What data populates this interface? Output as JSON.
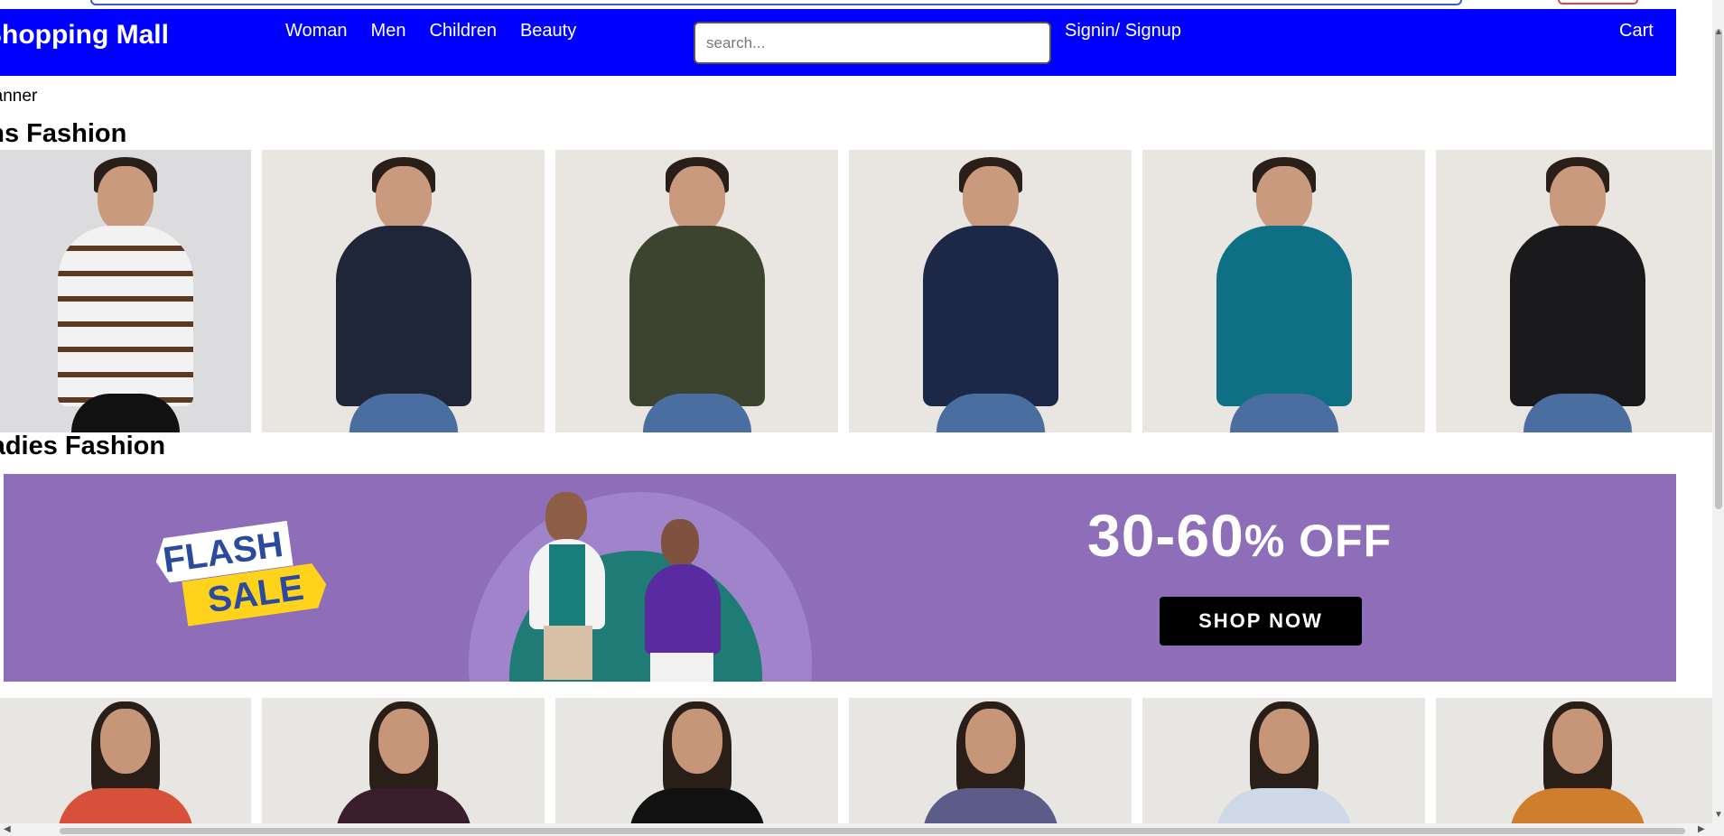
{
  "navbar": {
    "brand": "Shopping Mall",
    "links": [
      "Woman",
      "Men",
      "Children",
      "Beauty"
    ],
    "search_placeholder": "search...",
    "signin": "Signin/ Signup",
    "cart": "Cart",
    "bg_color": "#0000ff"
  },
  "banner_label": "Banner",
  "sections": {
    "mens_title": "Mens Fashion",
    "ladies_title": "Ladies Fashion"
  },
  "mens_products": [
    {
      "shirt": "#f2f2f2",
      "stripe": "#5a3a22"
    },
    {
      "shirt": "#1f2638"
    },
    {
      "shirt": "#3c4430"
    },
    {
      "shirt": "#1c2845"
    },
    {
      "shirt": "#0f6f85"
    },
    {
      "shirt": "#1a1a1c"
    }
  ],
  "promo": {
    "flash": "FLASH",
    "sale": "SALE",
    "discount": "30-60",
    "discount_suffix": "% OFF",
    "cta": "SHOP NOW"
  },
  "ladies_products": [
    {
      "top": "#d9503a"
    },
    {
      "top": "#3a1e2c"
    },
    {
      "top": "#111111"
    },
    {
      "top": "#5b5d88"
    },
    {
      "top": "#cfd8e6"
    },
    {
      "top": "#d07e2e"
    }
  ]
}
